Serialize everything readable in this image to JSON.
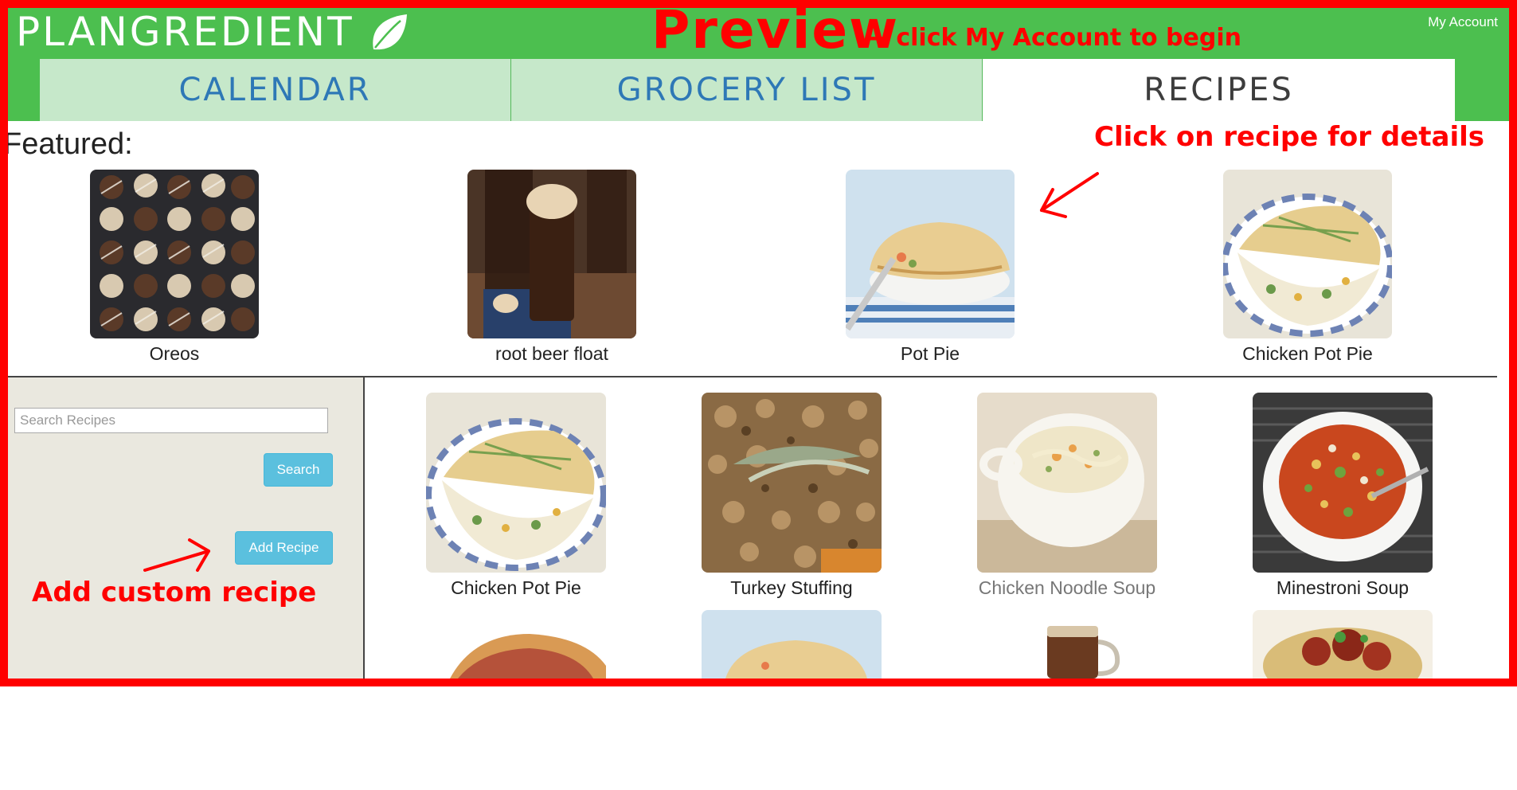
{
  "header": {
    "brand": "PLANGREDIENT",
    "preview_title": "Preview",
    "preview_subtitle": "-- click My Account to begin",
    "account_link": "My Account"
  },
  "tabs": [
    {
      "label": "CALENDAR",
      "active": false
    },
    {
      "label": "GROCERY LIST",
      "active": false
    },
    {
      "label": "RECIPES",
      "active": true
    }
  ],
  "featured": {
    "title": "Featured:",
    "annotation": "Click on recipe for details",
    "items": [
      {
        "name": "Oreos"
      },
      {
        "name": "root beer float"
      },
      {
        "name": "Pot Pie"
      },
      {
        "name": "Chicken Pot Pie"
      }
    ]
  },
  "sidebar": {
    "search_placeholder": "Search Recipes",
    "search_button": "Search",
    "add_button": "Add Recipe",
    "annotation": "Add custom recipe"
  },
  "recipes": [
    {
      "name": "Chicken Pot Pie"
    },
    {
      "name": "Turkey Stuffing"
    },
    {
      "name": "Chicken Noodle Soup"
    },
    {
      "name": "Minestroni Soup"
    }
  ],
  "colors": {
    "header_green": "#4cbf4f",
    "tab_inactive": "#c6e8ca",
    "tab_text": "#2e78b6",
    "annotation_red": "#ff0000",
    "button_blue": "#5bc0de",
    "sidebar_bg": "#eae8df"
  },
  "icons": [
    "leaf-icon",
    "arrow-icon"
  ]
}
